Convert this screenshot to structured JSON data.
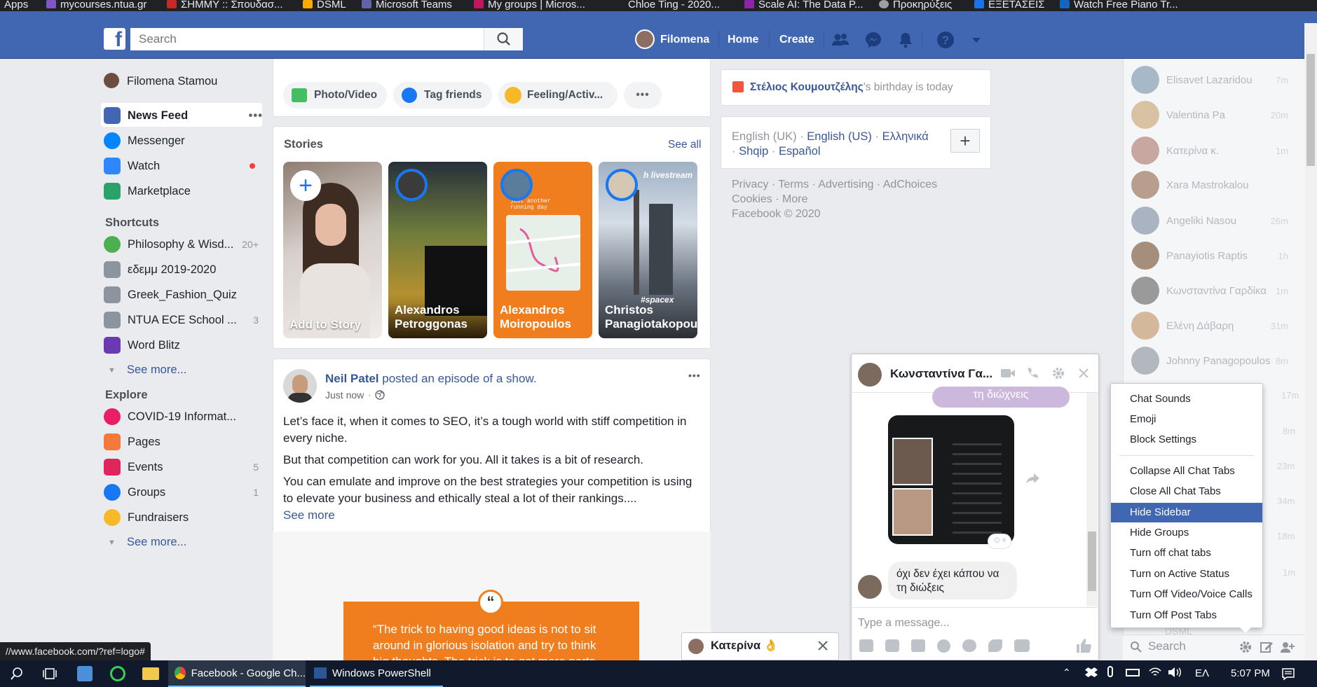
{
  "bookmarks": [
    {
      "label": "Apps",
      "color": "#8ab4f8"
    },
    {
      "label": "mycourses.ntua.gr",
      "color": "#7e57c2"
    },
    {
      "label": "ΣΗΜΜΥ :: Σπουδασ...",
      "color": "#c62828"
    },
    {
      "label": "DSML",
      "color": "#f9ab00"
    },
    {
      "label": "Microsoft Teams",
      "color": "#6264a7"
    },
    {
      "label": "My groups | Micros...",
      "color": "#c2185b"
    },
    {
      "label": "Chloe Ting - 2020...",
      "color": "#202124"
    },
    {
      "label": "Scale AI: The Data P...",
      "color": "#8e24aa"
    },
    {
      "label": "Προκηρύξεις",
      "color": "#9e9e9e"
    },
    {
      "label": "ΕΞΕΤΑΣΕΙΣ",
      "color": "#1a73e8"
    },
    {
      "label": "Watch Free Piano Tr...",
      "color": "#1565c0"
    }
  ],
  "header": {
    "search_placeholder": "Search",
    "user": "Filomena",
    "home": "Home",
    "create": "Create"
  },
  "leftnav": {
    "profile": "Filomena Stamou",
    "main": [
      {
        "label": "News Feed",
        "icon": "news-feed-icon",
        "color": "#4267b2"
      },
      {
        "label": "Messenger",
        "icon": "messenger-icon",
        "color": "#0084ff"
      },
      {
        "label": "Watch",
        "icon": "watch-icon",
        "color": "#2d88ff"
      },
      {
        "label": "Marketplace",
        "icon": "marketplace-icon",
        "color": "#2ba26a"
      }
    ],
    "shortcuts_title": "Shortcuts",
    "shortcuts": [
      {
        "label": "Philosophy & Wisd...",
        "count": "20+",
        "color": "#4caf50"
      },
      {
        "label": "εδεμμ 2019-2020",
        "count": "",
        "color": "#8d949e"
      },
      {
        "label": "Greek_Fashion_Quiz",
        "count": "",
        "color": "#8d949e"
      },
      {
        "label": "NTUA ECE School ...",
        "count": "3",
        "color": "#8d949e"
      },
      {
        "label": "Word Blitz",
        "count": "",
        "color": "#6a3ab2"
      }
    ],
    "see_more": "See more...",
    "explore_title": "Explore",
    "explore": [
      {
        "label": "COVID-19 Informat...",
        "count": "",
        "color": "#e91e63"
      },
      {
        "label": "Pages",
        "count": "",
        "color": "#f5793a"
      },
      {
        "label": "Events",
        "count": "5",
        "color": "#e0245e"
      },
      {
        "label": "Groups",
        "count": "1",
        "color": "#1877f2"
      },
      {
        "label": "Fundraisers",
        "count": "",
        "color": "#f7b928"
      }
    ]
  },
  "composer": {
    "photo": "Photo/Video",
    "tag": "Tag friends",
    "feeling": "Feeling/Activ...",
    "more": "•••"
  },
  "stories": {
    "title": "Stories",
    "see_all": "See all",
    "items": [
      {
        "name": "Add to Story",
        "bg": "#c9bfb8"
      },
      {
        "name": "Alexandros\nPetroggonas",
        "bg": "#5c6a3d"
      },
      {
        "name": "Alexandros\nMoiropoulos",
        "bg": "#f07d1e"
      },
      {
        "name": "Christos\nPanagiotakopoulos",
        "bg": "#6b7a8c"
      }
    ],
    "story2_overlay": "h livestream",
    "story3_overlay": "just another\nrunning day",
    "story4_tag": "#spacex"
  },
  "post": {
    "author": "Neil Patel",
    "action": " posted an episode of a ",
    "show": "show.",
    "time": "Just now",
    "p1": "Let’s face it, when it comes to SEO, it’s a tough world with stiff competition in every niche.",
    "p2": "But that competition can work for you. All it takes is a bit of research.",
    "p3": "You can emulate and improve on the best strategies your competition is using to elevate your business and ethically steal a lot of their rankings....",
    "see_more": "See more",
    "quote": "“The trick to having good ideas is not to sit around in glorious isolation and try to think big thoughts. The trick is to get more parts"
  },
  "right": {
    "birthday_name": "Στέλιος Κουμουτζέλης",
    "birthday_text": "'s birthday is today",
    "langs": "English (UK) · English (US) · Ελληνικά · Shqip · Español",
    "lang_current": "English (UK)",
    "lang_links": [
      "English (US)",
      "Ελληνικά",
      "Shqip",
      "Español"
    ],
    "footer1": "Privacy · Terms · Advertising · AdChoices",
    "footer2": "Cookies · More",
    "copyright": "Facebook © 2020"
  },
  "chat_sidebar": {
    "contacts": [
      {
        "name": "Elisavet Lazaridou",
        "time": "7m",
        "color": "#a7b9c9"
      },
      {
        "name": "Valentina Pa",
        "time": "20m",
        "color": "#d9c1a4"
      },
      {
        "name": "Κατερίνα κ.",
        "time": "1m",
        "color": "#c9a7a1"
      },
      {
        "name": "Xara Mastrokalou",
        "time": "",
        "color": "#b79e8e"
      },
      {
        "name": "Angeliki Nasou",
        "time": "26m",
        "color": "#a9b3c2"
      },
      {
        "name": "Panayiotis Raptis",
        "time": "1h",
        "color": "#a58f7c"
      },
      {
        "name": "Κωνσταντίνα Γαρδίκα",
        "time": "1m",
        "color": "#9a9a9a"
      },
      {
        "name": "Ελένη Δάβαρη",
        "time": "31m",
        "color": "#d4b89b"
      },
      {
        "name": "Johnny Panagopoulos",
        "time": "8m",
        "color": "#b3b8bf"
      }
    ],
    "extra_times": [
      "17m",
      "8m",
      "23m",
      "34m",
      "18m",
      "1m"
    ],
    "bottom_name": "DSML",
    "search_placeholder": "Search"
  },
  "chat_window": {
    "name": "Κωνσταντίνα Γα...",
    "bubble_top": "τη διώχνεις",
    "message": "όχι δεν έχει κάπου να\nτη διώξεις",
    "input_placeholder": "Type a message..."
  },
  "chat_tab2": {
    "name": "Κατερίνα",
    "emoji": "👌"
  },
  "menu": {
    "group1": [
      "Chat Sounds",
      "Emoji",
      "Block Settings"
    ],
    "group2": [
      "Collapse All Chat Tabs",
      "Close All Chat Tabs",
      "Hide Sidebar",
      "Hide Groups",
      "Turn off chat tabs",
      "Turn on Active Status",
      "Turn Off Video/Voice Calls",
      "Turn Off Post Tabs"
    ],
    "selected": "Hide Sidebar"
  },
  "statusbar_url": "//www.facebook.com/?ref=logo#",
  "taskbar": {
    "chrome": "Facebook - Google Ch...",
    "powershell": "Windows PowerShell",
    "lang": "ΕΛ",
    "time": "5:07 PM"
  }
}
